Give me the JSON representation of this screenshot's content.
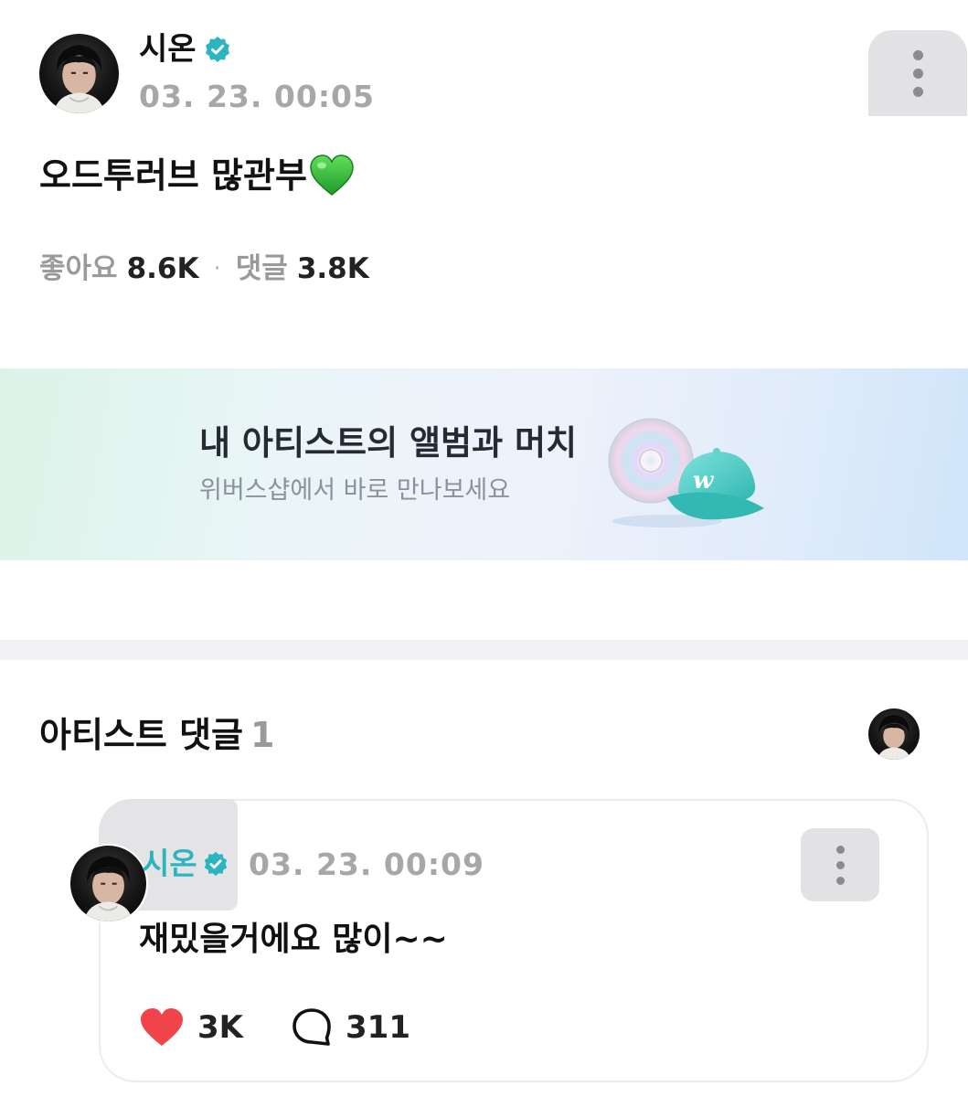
{
  "post": {
    "author": "시온",
    "timestamp": "03. 23. 00:05",
    "text": "오드투러브 많관부",
    "stats": {
      "like_label": "좋아요",
      "like_count": "8.6K",
      "separator": "·",
      "comment_label": "댓글",
      "comment_count": "3.8K"
    }
  },
  "banner": {
    "title": "내 아티스트의 앨범과 머치",
    "subtitle": "위버스샵에서 바로 만나보세요"
  },
  "artist_comments": {
    "title": "아티스트 댓글",
    "count": "1",
    "comment": {
      "author": "시온",
      "timestamp": "03. 23. 00:09",
      "text": "재밌을거에요 많이~~",
      "likes": "3K",
      "replies": "311"
    }
  },
  "colors": {
    "verified_badge": "#2cb5c0",
    "artist_name": "#2cb5c0",
    "like_heart": "#f0444a",
    "banner_gradient_start": "#dbf4e8",
    "banner_gradient_end": "#cfe5fa"
  }
}
